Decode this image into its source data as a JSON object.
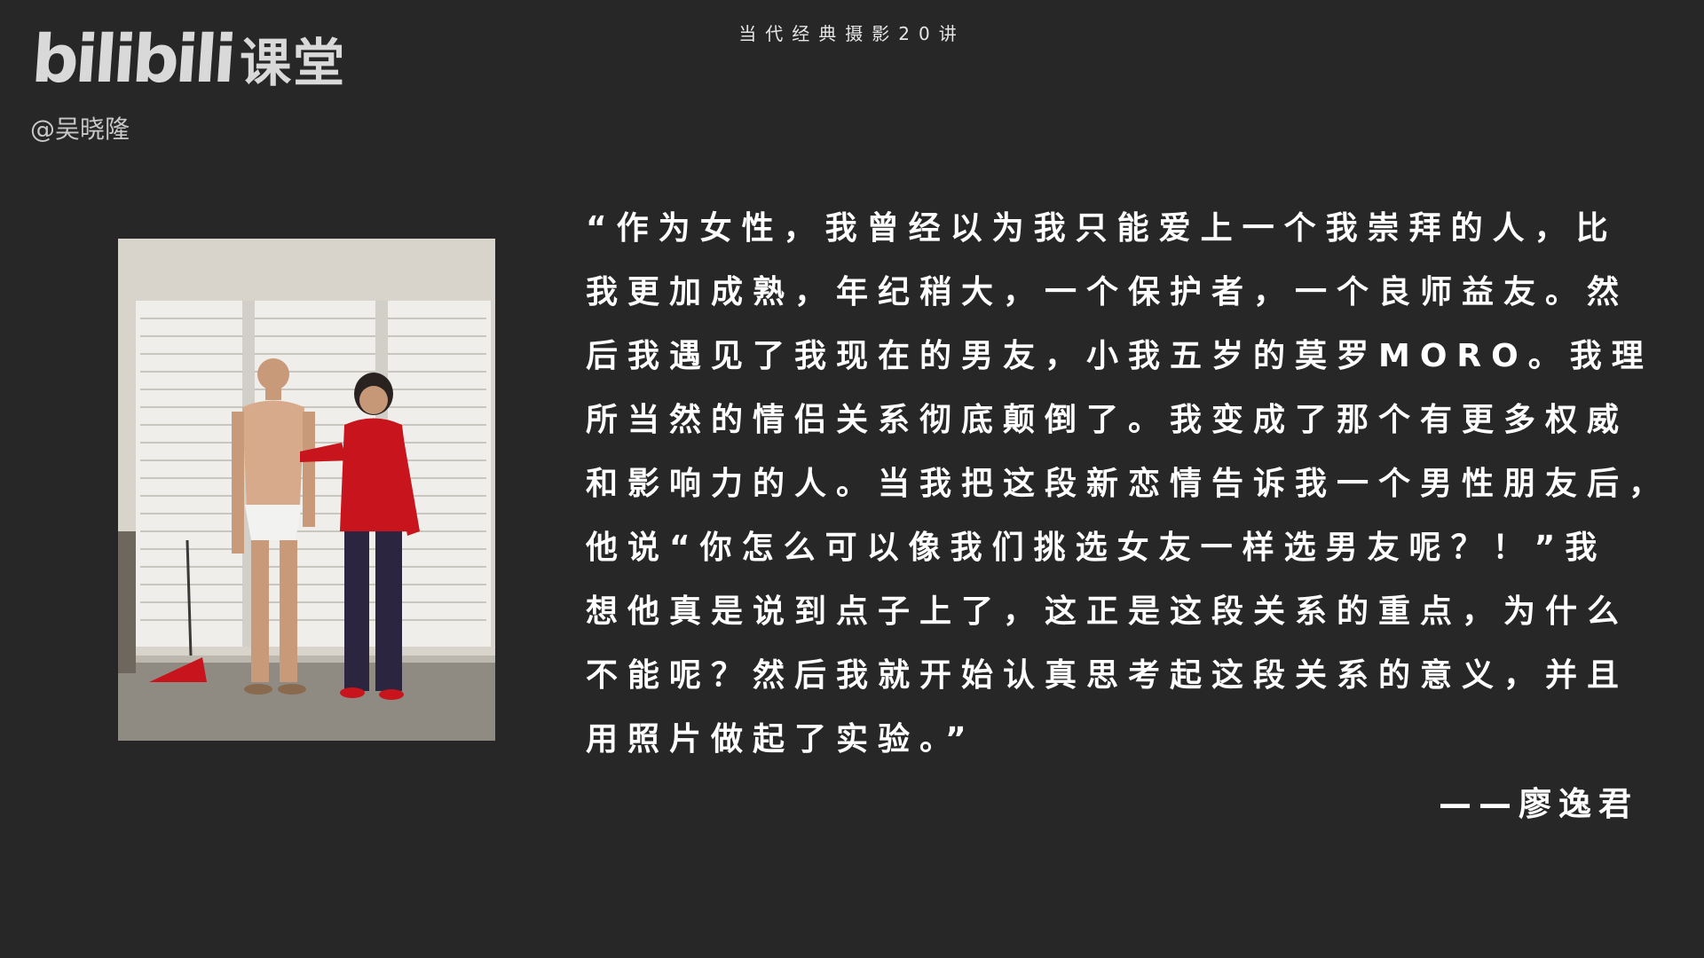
{
  "header": {
    "course_title": "当代经典摄影20讲"
  },
  "brand": {
    "logo_wordmark": "bilibili",
    "logo_suffix": "课堂",
    "author_handle": "@吴晓隆"
  },
  "quote": {
    "lines": [
      "“作为女性，我曾经以为我只能爱上一个我崇拜的人，比",
      "我更加成熟，年纪稍大，一个保护者，一个良师益友。然",
      "后我遇见了我现在的男友，小我五岁的莫罗MORO。我理",
      "所当然的情侣关系彻底颠倒了。我变成了那个有更多权威",
      "和影响力的人。当我把这段新恋情告诉我一个男性朋友后，",
      "他说“你怎么可以像我们挑选女友一样选男友呢？！”我",
      "想他真是说到点子上了，这正是这段关系的重点，为什么",
      "不能呢？然后我就开始认真思考起这段关系的意义，并且",
      "用照片做起了实验。”"
    ],
    "attribution": "——廖逸君"
  },
  "colors": {
    "background": "#272727",
    "text": "#ffffff",
    "red_blouse": "#c8141c"
  }
}
